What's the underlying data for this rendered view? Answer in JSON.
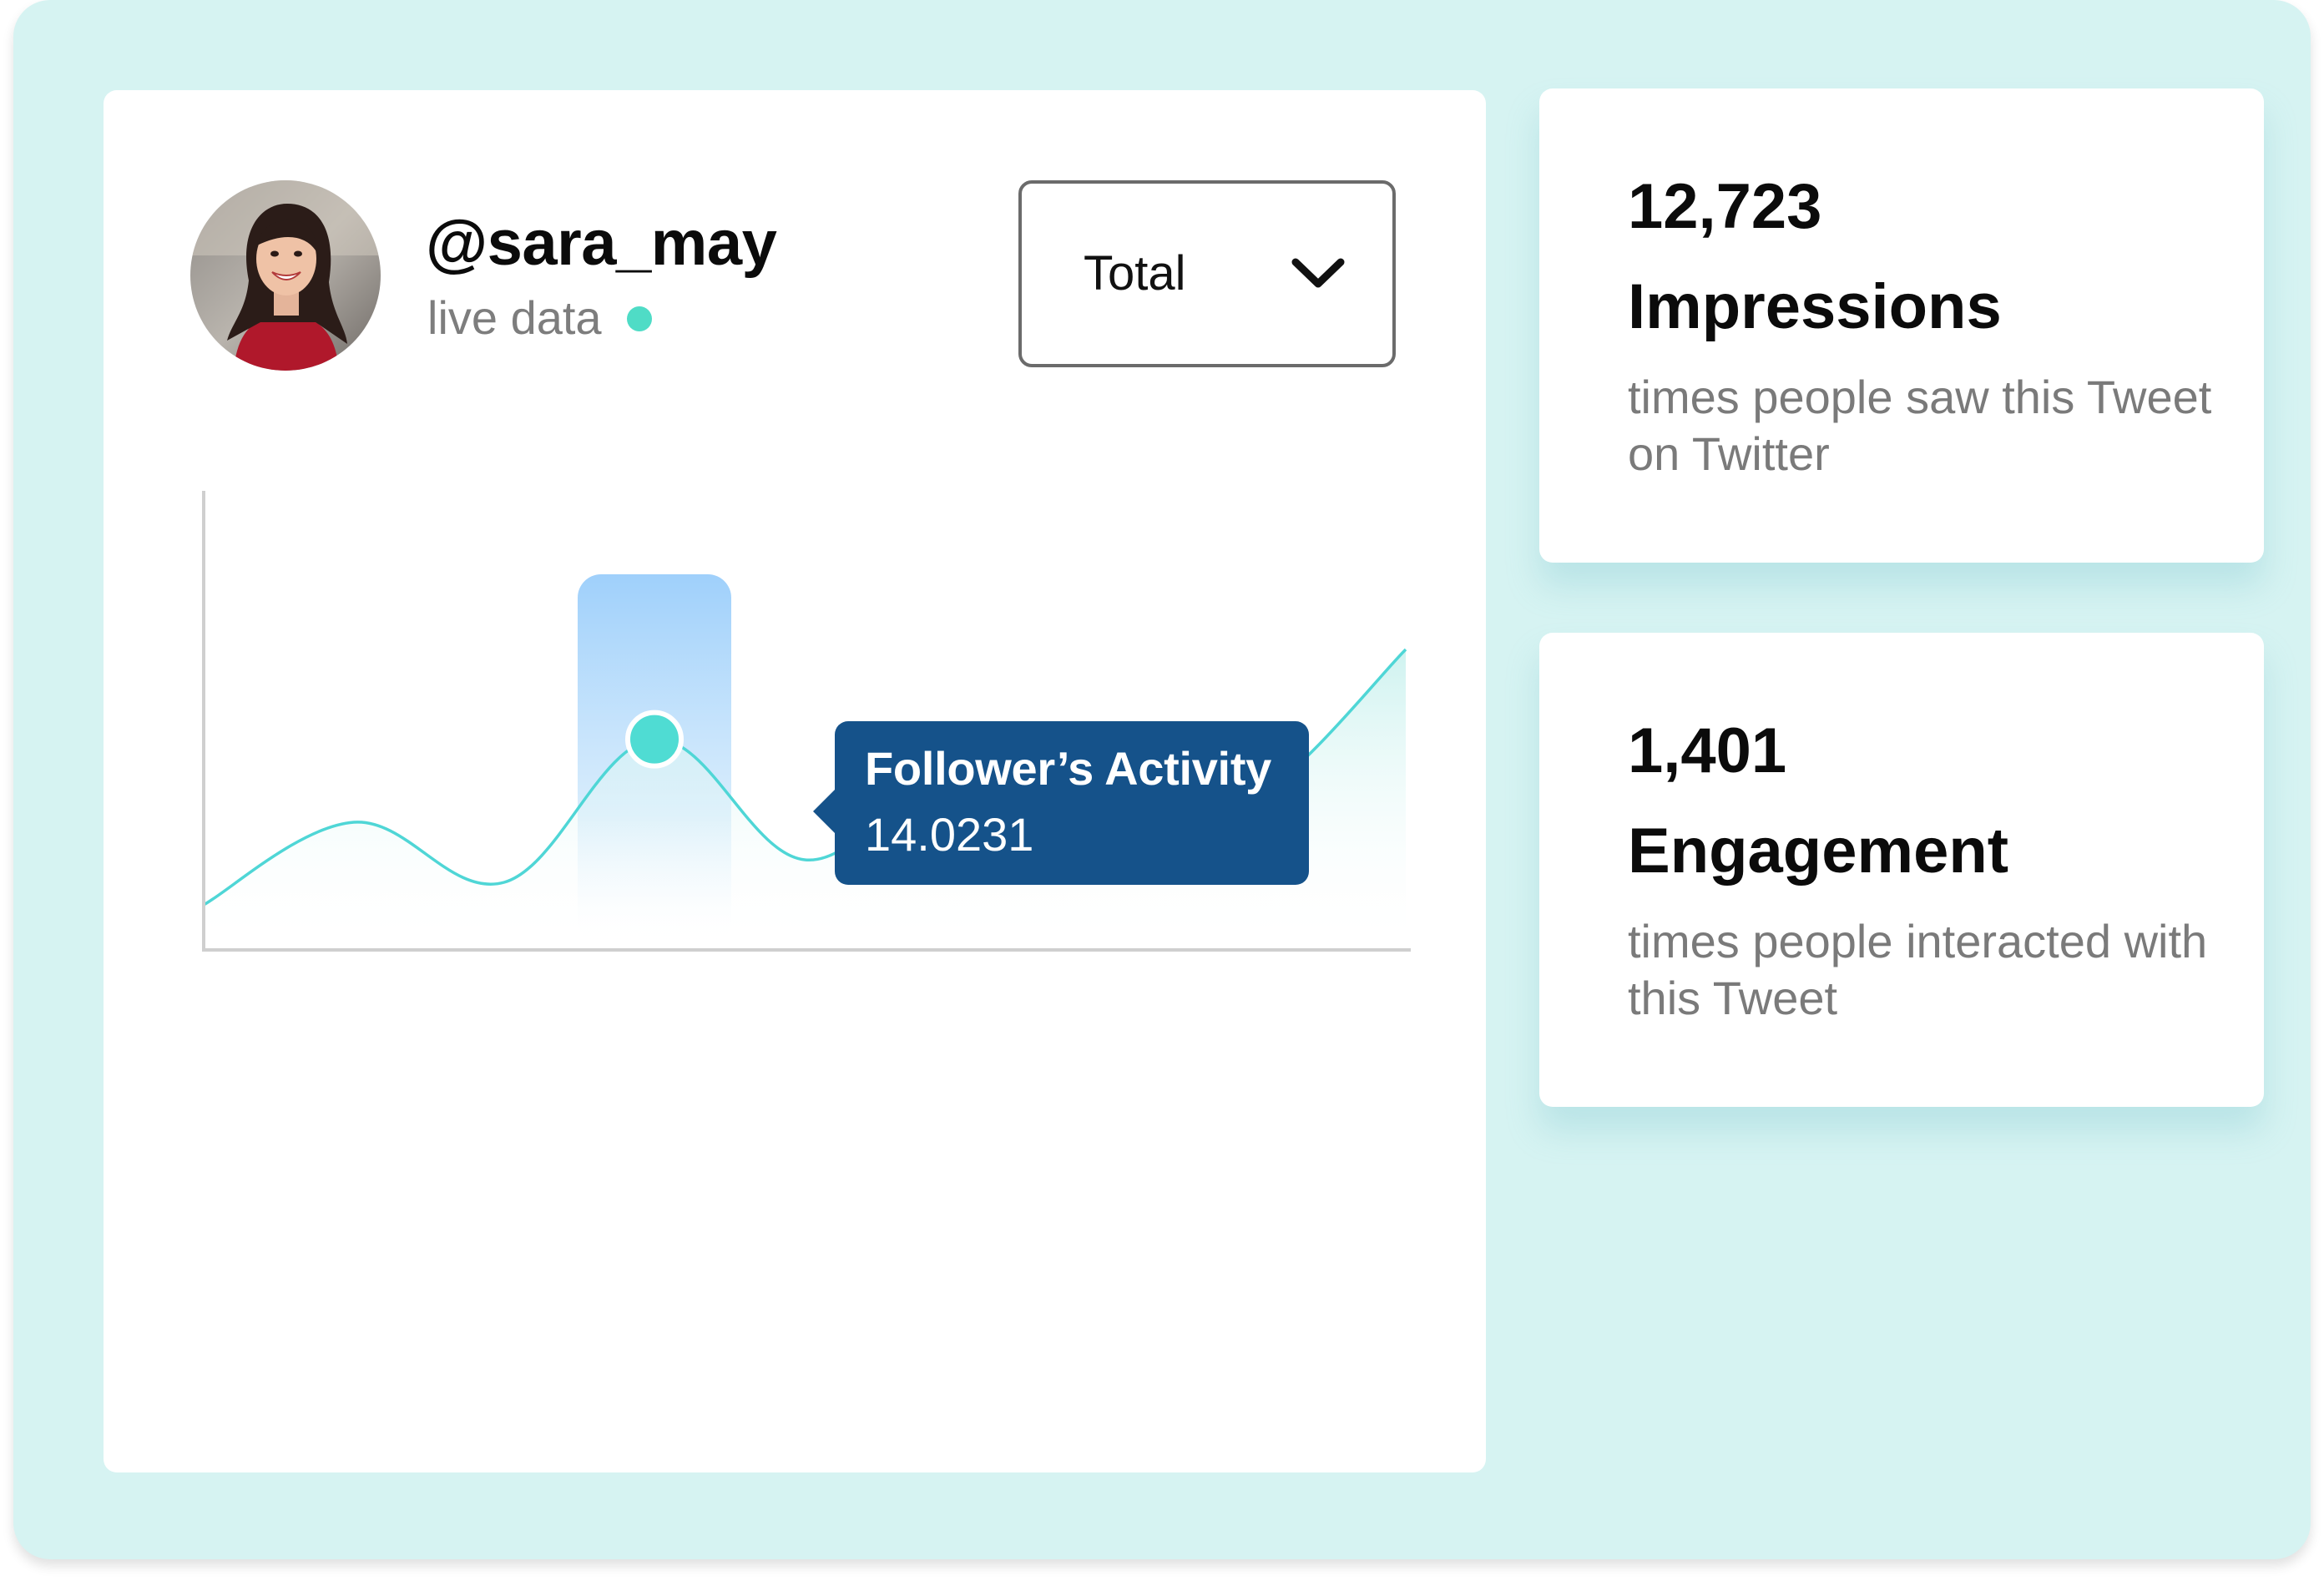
{
  "profile": {
    "username": "@sara_may",
    "status_text": "live data",
    "status_color": "#4fdcc6",
    "avatar_icon": "avatar-photo"
  },
  "dropdown": {
    "selected": "Total",
    "icon": "chevron-down-icon"
  },
  "colors": {
    "background": "#d6f3f2",
    "line": "#4fd6d6",
    "tooltip": "#15528a",
    "highlight": "#9fd0fb"
  },
  "chart_data": {
    "type": "area",
    "x": [
      0,
      1,
      2,
      3,
      4,
      5,
      6,
      7,
      8
    ],
    "series": [
      {
        "values": [
          3,
          8.5,
          4.5,
          14.0231,
          6,
          12,
          7,
          10,
          20
        ]
      }
    ],
    "highlighted_index": 3,
    "grid": false,
    "tooltip": {
      "title": "Follower’s Activity",
      "value": "14.0231"
    }
  },
  "stats": [
    {
      "value": "12,723",
      "title": "Impressions",
      "description": "times people saw this Tweet on Twitter"
    },
    {
      "value": "1,401",
      "title": "Engagement",
      "description": "times people interacted with this Tweet"
    }
  ]
}
